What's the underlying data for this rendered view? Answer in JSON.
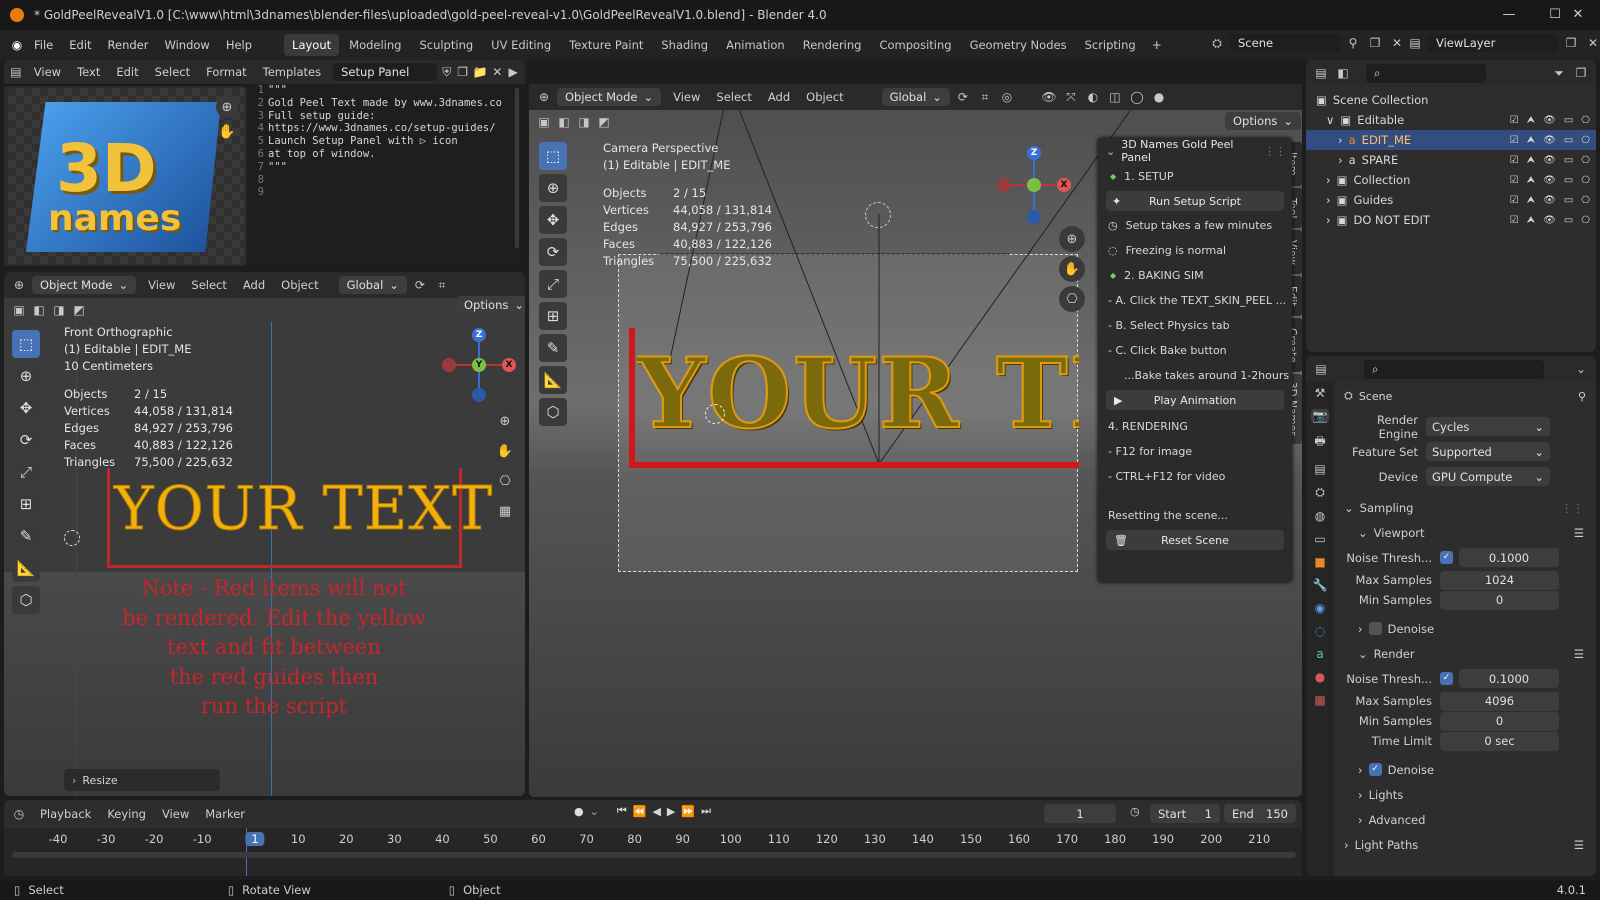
{
  "window": {
    "title": "* GoldPeelRevealV1.0 [C:\\www\\html\\3dnames\\blender-files\\uploaded\\gold-peel-reveal-v1.0\\GoldPeelRevealV1.0.blend] - Blender 4.0"
  },
  "menu": [
    "File",
    "Edit",
    "Render",
    "Window",
    "Help"
  ],
  "workspaces": [
    "Layout",
    "Modeling",
    "Sculpting",
    "UV Editing",
    "Texture Paint",
    "Shading",
    "Animation",
    "Rendering",
    "Compositing",
    "Geometry Nodes",
    "Scripting"
  ],
  "scene_name": "Scene",
  "viewlayer_name": "ViewLayer",
  "text_editor": {
    "menus": [
      "View",
      "Text",
      "Edit",
      "Select",
      "Format",
      "Templates"
    ],
    "filename": "Setup Panel",
    "line_numbers": [
      "1",
      "2",
      "3",
      "4",
      "5",
      "6",
      "7",
      "8",
      "9"
    ],
    "lines": [
      "\"\"\"",
      "Gold Peel Text made by www.3dnames.co",
      "",
      "Full setup guide:",
      "https://www.3dnames.co/setup-guides/",
      "",
      "Launch Setup Panel with ▷ icon",
      "at top of window.",
      "\"\"\""
    ]
  },
  "logo": {
    "line1": "3D",
    "line2": "names"
  },
  "left_viewport": {
    "mode": "Object Mode",
    "menus": [
      "View",
      "Select",
      "Add",
      "Object"
    ],
    "orientation": "Global",
    "options": "Options",
    "view_name": "Front Orthographic",
    "collection": "(1) Editable | EDIT_ME",
    "scale": "10 Centimeters",
    "stats": [
      {
        "k": "Objects",
        "v": "2 / 15"
      },
      {
        "k": "Vertices",
        "v": "44,058 / 131,814"
      },
      {
        "k": "Edges",
        "v": "84,927 / 253,796"
      },
      {
        "k": "Faces",
        "v": "40,883 / 122,126"
      },
      {
        "k": "Triangles",
        "v": "75,500 / 225,632"
      }
    ],
    "yellow_text": "YOUR TEXT",
    "note_lines": [
      "Note - Red items will not",
      "be rendered. Edit the yellow",
      "text and fit between",
      "the red guides then",
      "run the script"
    ],
    "operator": "Resize"
  },
  "main_viewport": {
    "mode": "Object Mode",
    "menus": [
      "View",
      "Select",
      "Add",
      "Object"
    ],
    "orientation": "Global",
    "options": "Options",
    "view_name": "Camera Perspective",
    "collection": "(1) Editable | EDIT_ME",
    "stats": [
      {
        "k": "Objects",
        "v": "2 / 15"
      },
      {
        "k": "Vertices",
        "v": "44,058 / 131,814"
      },
      {
        "k": "Edges",
        "v": "84,927 / 253,796"
      },
      {
        "k": "Faces",
        "v": "40,883 / 122,126"
      },
      {
        "k": "Triangles",
        "v": "75,500 / 225,632"
      }
    ],
    "gold_text": "YOUR TEX",
    "tabs": [
      "Item",
      "Tool",
      "View",
      "Edit",
      "Create",
      "3D Names"
    ]
  },
  "npanel": {
    "title": "3D Names Gold Peel Panel",
    "setup": "1. SETUP",
    "run_button": "Run Setup Script",
    "info1": "Setup takes a few minutes",
    "info2": "Freezing is normal",
    "baking": "2. BAKING SIM",
    "stepA": "- A. Click the TEXT_SKIN_PEEL ...",
    "stepB": "- B. Select Physics tab",
    "stepC": "- C. Click Bake button",
    "bake_note": "...Bake takes around 1-2hours",
    "play_button": "Play Animation",
    "rendering": "4. RENDERING",
    "f12": "- F12 for image",
    "ctrlf12": "- CTRL+F12 for video",
    "resetting": "Resetting the scene...",
    "reset_button": "Reset Scene"
  },
  "outliner": {
    "root": "Scene Collection",
    "items": [
      {
        "name": "Editable",
        "indent": 1,
        "exp": "∨"
      },
      {
        "name": "EDIT_ME",
        "indent": 2,
        "exp": "›"
      },
      {
        "name": "SPARE",
        "indent": 2,
        "exp": "›"
      },
      {
        "name": "Collection",
        "indent": 1,
        "exp": "›"
      },
      {
        "name": "Guides",
        "indent": 1,
        "exp": "›"
      },
      {
        "name": "DO NOT EDIT",
        "indent": 1,
        "exp": "›"
      }
    ]
  },
  "properties": {
    "scene": "Scene",
    "render_engine": {
      "label": "Render Engine",
      "value": "Cycles"
    },
    "feature_set": {
      "label": "Feature Set",
      "value": "Supported"
    },
    "device": {
      "label": "Device",
      "value": "GPU Compute"
    },
    "sampling": "Sampling",
    "viewport": "Viewport",
    "vp_noise": {
      "label": "Noise Thresh...",
      "value": "0.1000"
    },
    "vp_max": {
      "label": "Max Samples",
      "value": "1024"
    },
    "vp_min": {
      "label": "Min Samples",
      "value": "0"
    },
    "denoise": "Denoise",
    "render": "Render",
    "r_noise": {
      "label": "Noise Thresh...",
      "value": "0.1000"
    },
    "r_max": {
      "label": "Max Samples",
      "value": "4096"
    },
    "r_min": {
      "label": "Min Samples",
      "value": "0"
    },
    "r_time": {
      "label": "Time Limit",
      "value": "0 sec"
    },
    "lights": "Lights",
    "advanced": "Advanced",
    "light_paths": "Light Paths"
  },
  "timeline": {
    "menus": [
      "Playback",
      "Keying",
      "View",
      "Marker"
    ],
    "current_frame": "1",
    "start_label": "Start",
    "start": "1",
    "end_label": "End",
    "end": "150",
    "ticks": [
      "-40",
      "-30",
      "-20",
      "-10",
      "1",
      "10",
      "20",
      "30",
      "40",
      "50",
      "60",
      "70",
      "80",
      "90",
      "100",
      "110",
      "120",
      "130",
      "140",
      "150",
      "160",
      "170",
      "180",
      "190",
      "200",
      "210"
    ]
  },
  "statusbar": {
    "select": "Select",
    "rotate": "Rotate View",
    "object": "Object",
    "version": "4.0.1"
  }
}
